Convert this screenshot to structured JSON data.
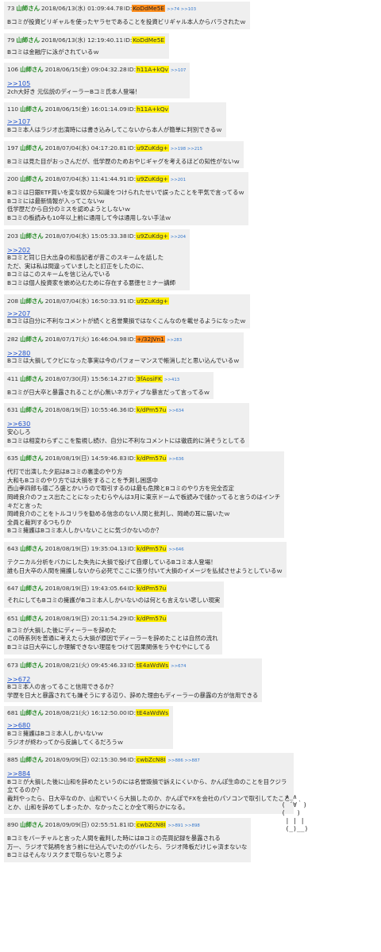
{
  "posts": [
    {
      "num": "73",
      "name": "山師さん",
      "date": "2018/06/13(水) 01:09:44.78",
      "id_prefix": "ID:",
      "id": "KoDdMe5E",
      "id_color": "orange",
      "replies": ">>74 >>103",
      "lines": [
        "Bコミが投資ビリギャルを使ったヤラセであることを投資ビリギャル本人からバラされたｗ"
      ]
    },
    {
      "num": "79",
      "name": "山師さん",
      "date": "2018/06/13(水) 12:19:40.11",
      "id_prefix": "ID:",
      "id": "KoDdMe5E",
      "id_color": "yellow",
      "replies": "",
      "lines": [
        "Bコミは金融庁に泳がされているｗ"
      ]
    },
    {
      "num": "106",
      "name": "山師さん",
      "date": "2018/06/15(金) 09:04:32.28",
      "id_prefix": "ID:",
      "id": "h11A+kQv",
      "id_color": "yellow",
      "replies": ">>107",
      "anchor": ">>105",
      "lines": [
        "2ch大好き 元伝説のディーラーBコミ氏本人登場！"
      ]
    },
    {
      "num": "110",
      "name": "山師さん",
      "date": "2018/06/15(金) 16:01:14.09",
      "id_prefix": "ID:",
      "id": "h11A+kQv",
      "id_color": "yellow",
      "replies": "",
      "anchor": ">>107",
      "lines": [
        "Bコミ本人はラジオ出演時には書き込みしてこないから本人が簡単に判別できるｗ"
      ]
    },
    {
      "num": "197",
      "name": "山師さん",
      "date": "2018/07/04(水) 04:17:20.81",
      "id_prefix": "ID:",
      "id": "u9ZuKdg+",
      "id_color": "yellow",
      "replies": ">>198 >>215",
      "lines": [
        "Bコミは見た目がおっさんだが、低学歴のためおやじギャグを考えるほどの知性がないｗ"
      ]
    },
    {
      "num": "200",
      "name": "山師さん",
      "date": "2018/07/04(水) 11:41:44.91",
      "id_prefix": "ID:",
      "id": "u9ZuKdg+",
      "id_color": "yellow",
      "replies": ">>201",
      "lines": [
        "Bコミは日銀ETF買いを変な奴から知識をつけられたせいで誤ったことを平気で言ってるｗ",
        "Bコミには最新情報が入ってこないｗ",
        "低学歴だから自分のミスを認めようとしないｗ",
        "Bコミの板読みも10年以上前に通用して今は通用しない手法ｗ"
      ]
    },
    {
      "num": "203",
      "name": "山師さん",
      "date": "2018/07/04(水) 15:05:33.38",
      "id_prefix": "ID:",
      "id": "u9ZuKdg+",
      "id_color": "yellow",
      "replies": ">>204",
      "anchor": ">>202",
      "lines": [
        "Bコミと同じ日大出身の和島記者が昔このスキームを話した",
        "ただ、実は私は間違っていましたと訂正をしたのに、",
        "Bコミはこのスキームを信じ込んでいる",
        "Bコミは個人投資家を嵌め込むために存在する悪徳セミナー講師"
      ]
    },
    {
      "num": "208",
      "name": "山師さん",
      "date": "2018/07/04(水) 16:50:33.91",
      "id_prefix": "ID:",
      "id": "u9ZuKdg+",
      "id_color": "yellow",
      "replies": "",
      "anchor": ">>207",
      "lines": [
        "Bコミは自分に不利なコメントが続くと名誉棄損ではなくこんなのを載せるようになったｗ"
      ]
    },
    {
      "num": "282",
      "name": "山師さん",
      "date": "2018/07/17(火) 16:46:04.98",
      "id_prefix": "ID:",
      "id": "+/32JVn1",
      "id_color": "orange",
      "replies": ">>283",
      "anchor": ">>280",
      "lines": [
        "Bコミは大損してクビになった事実は今のパフォーマンスで帳消しだと思い込んでいるｗ"
      ]
    },
    {
      "num": "411",
      "name": "山師さん",
      "date": "2018/07/30(月) 15:56:14.27",
      "id_prefix": "ID:",
      "id": "3fAosiFK",
      "id_color": "yellow",
      "replies": ">>413",
      "lines": [
        "Bコミが日大卒と暴露されることが心無いネガティブな暴言だって言ってるｗ"
      ]
    },
    {
      "num": "631",
      "name": "山師さん",
      "date": "2018/08/19(日) 10:55:46.36",
      "id_prefix": "ID:",
      "id": "k/dPm57u",
      "id_color": "yellow",
      "replies": ">>634",
      "anchor": ">>630",
      "lines": [
        "安心しろ",
        "Bコミは相変わらずここを監視し続け、自分に不利なコメントには徹底的に消そうとしてる"
      ]
    },
    {
      "num": "635",
      "name": "山師さん",
      "date": "2018/08/19(日) 14:59:46.83",
      "id_prefix": "ID:",
      "id": "k/dPm57u",
      "id_color": "yellow",
      "replies": ">>636",
      "lines": [
        "代打で出演した夕凪はBコミの裏塗のやり方",
        "大和もBコミのやり方では大損をすることを予測し困惑中",
        "西山孝四郎も德ごろ盛とかいうので取引するのは最も危険とBコミのやり方を完全否定",
        "岡崎良介のフェス出たことになったむらやんは3月に東京ドームで板読みで儲かってると言うのはインチ",
        "キだと言った",
        "岡崎良介のことをトルコリラを勧める信念のない人間と批判し、岡崎の耳に届いたｗ",
        "全員と裁判するつもりか",
        "Bコミ擁護はBコミ本人しかいないことに気づかないのか？"
      ]
    },
    {
      "num": "643",
      "name": "山師さん",
      "date": "2018/08/19(日) 19:35:04.13",
      "id_prefix": "ID:",
      "id": "k/dPm57u",
      "id_color": "yellow",
      "replies": ">>646",
      "lines": [
        "テクニカル分析をバカにした失先に大損で投げて自爆しているBコミ本人登場！",
        "誰も日大卒の人間を擁護しないから必死でここに張り付いて大損のイメージを払拭させようとしているｗ"
      ]
    },
    {
      "num": "647",
      "name": "山師さん",
      "date": "2018/08/19(日) 19:43:05.64",
      "id_prefix": "ID:",
      "id": "k/dPm57u",
      "id_color": "yellow",
      "replies": "",
      "lines": [
        "それにしてもBコミの擁護がBコミ本人しかいないのは何とも言えない悲しい現実"
      ]
    },
    {
      "num": "651",
      "name": "山師さん",
      "date": "2018/08/19(日) 20:11:54.29",
      "id_prefix": "ID:",
      "id": "k/dPm57u",
      "id_color": "yellow",
      "replies": "",
      "lines": [
        "Bコミが大損した後にディーラーを辞めた",
        "この時系列を普通に考えたら大損が原因でディーラーを辞めたことは自然の流れ",
        "Bコミは日大卒にしか理解できない理屈をつけて因果関係をうやむやにしてる"
      ]
    },
    {
      "num": "673",
      "name": "山師さん",
      "date": "2018/08/21(火) 09:45:46.33",
      "id_prefix": "ID:",
      "id": "tE4aWdWs",
      "id_color": "yellow",
      "replies": ">>674",
      "anchor": ">>672",
      "lines": [
        "Bコミ本人の言ってること信用できるか？",
        "学歴を日大と暴露されても嫌そうにする辺り、辞めた理由もディーラーの暴露の方が信用できる"
      ]
    },
    {
      "num": "681",
      "name": "山師さん",
      "date": "2018/08/21(火) 16:12:50.00",
      "id_prefix": "ID:",
      "id": "tE4aWdWs",
      "id_color": "yellow",
      "replies": "",
      "anchor": ">>680",
      "lines": [
        "Bコミ擁護はBコミ本人しかいないｗ",
        "ラジオが終わってから反論してくるだろうｗ"
      ]
    },
    {
      "num": "885",
      "name": "山師さん",
      "date": "2018/09/09(日) 02:15:30.96",
      "id_prefix": "ID:",
      "id": "cwbZcN8I",
      "id_color": "yellow",
      "replies": ">>886 >>887",
      "anchor": ">>884",
      "lines": [
        "Bコミが大損した後に山和を辞めたというのには名誉毀損で訴えにくいから、かんぽ生命のことを目クジラ",
        "立てるのか？",
        "裁判やったら、日大卒なのか、山和でいくら大損したのか、かんぽでFXを会社のパソコンで取引してたこと",
        "とか、山和を辞めてしまったか、なかったことか全て明らかになる。"
      ]
    },
    {
      "num": "890",
      "name": "山師さん",
      "date": "2018/09/09(日) 02:55:51.81",
      "id_prefix": "ID:",
      "id": "cwbZcN8I",
      "id_color": "yellow",
      "replies": ">>891 >>898",
      "lines": [
        "Bコミをバーチャルと言った人間を裁判した時にはBコミの売買記録を暴露される",
        "万一、ラジオで銘柄を言う前に仕込んでいたのがバレたら、ラジオ降板だけじゃ済まないな",
        "Bコミはそんなリスクまで取らないと思うよ"
      ]
    }
  ],
  "ascii_art": "   ∧_∧\n  ( ´∀｀)\n  (   )\n   | | |\n   (_)__)"
}
